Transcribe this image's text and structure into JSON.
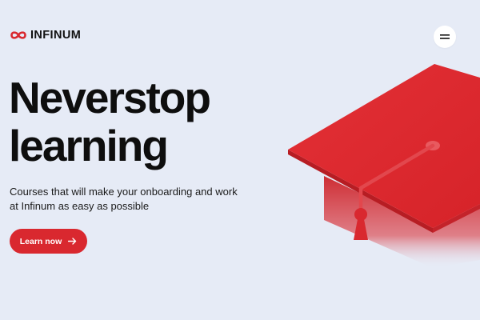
{
  "header": {
    "logo_text": "INFINUM",
    "logo_icon": "infinity-icon",
    "menu_icon": "hamburger-menu-icon"
  },
  "hero": {
    "title_line1": "Neverstop",
    "title_line2": "learning",
    "subtitle": "Courses that will make your onboarding and work at Infinum as easy as possible",
    "cta_label": "Learn now",
    "cta_icon": "arrow-right-icon",
    "illustration": "graduation-cap"
  },
  "colors": {
    "background": "#e6ebf6",
    "accent": "#d9282f",
    "text": "#0e0e0e"
  }
}
